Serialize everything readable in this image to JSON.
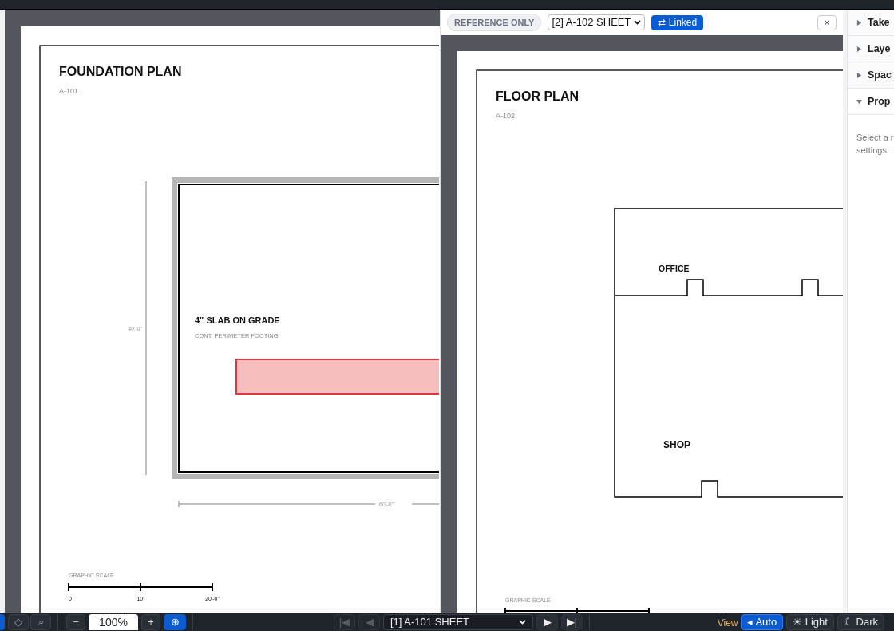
{
  "left_sheet": {
    "title": "FOUNDATION PLAN",
    "number": "A-101",
    "note_title": "4\" SLAB ON GRADE",
    "note_text": "CONT. PERIMETER FOOTING",
    "dim_vertical": "40'-0\"",
    "dim_horizontal": "60'-0\"",
    "scale_label": "GRAPHIC SCALE",
    "scale_marks": [
      "0",
      "10'",
      "20'-0\""
    ]
  },
  "reference_pane": {
    "badge": "REFERENCE ONLY",
    "sheet_select": "[2] A-102 SHEET",
    "link_button": "⇄ Linked",
    "linked": true,
    "close_button": "×",
    "sheet": {
      "title": "FLOOR PLAN",
      "number": "A-102",
      "rooms": [
        "OFFICE",
        "SHOP"
      ],
      "scale_label": "GRAPHIC SCALE"
    }
  },
  "sidebar": {
    "sections": [
      {
        "label": "Take",
        "expanded": false
      },
      {
        "label": "Laye",
        "expanded": false
      },
      {
        "label": "Spac",
        "expanded": false
      },
      {
        "label": "Prop",
        "expanded": true
      }
    ],
    "hint_lines": [
      "Select a r",
      "settings."
    ]
  },
  "toolbar": {
    "tool_buttons": [
      {
        "label": "◇",
        "selected": false
      },
      {
        "label": "⌕",
        "selected": false
      }
    ],
    "zoom_out": "−",
    "zoom_value": "100%",
    "zoom_in": "+",
    "fit_button": "⊕",
    "nav": [
      {
        "label": "|◀",
        "disabled": true
      },
      {
        "label": "◀",
        "disabled": true
      }
    ],
    "sheet_select": "[1] A-101 SHEET",
    "nav_next": [
      {
        "label": "▶",
        "disabled": false
      },
      {
        "label": "▶|",
        "disabled": false
      }
    ],
    "view_label": "View",
    "themes": [
      {
        "label": "◂ Auto",
        "selected": true
      },
      {
        "label": "☀ Light",
        "selected": false
      },
      {
        "label": "☾ Dark",
        "selected": false
      }
    ]
  }
}
